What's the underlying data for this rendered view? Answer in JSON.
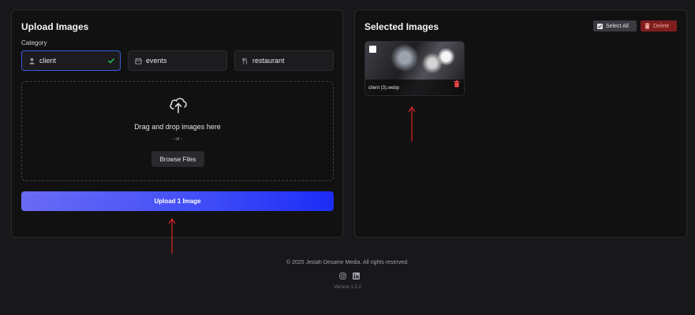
{
  "upload": {
    "title": "Upload Images",
    "category_label": "Category",
    "categories": [
      {
        "label": "client",
        "icon": "user-icon",
        "active": true
      },
      {
        "label": "events",
        "icon": "calendar-icon",
        "active": false
      },
      {
        "label": "restaurant",
        "icon": "utensils-icon",
        "active": false
      }
    ],
    "dropzone": {
      "text": "Drag and drop images here",
      "or": "- or -",
      "browse_label": "Browse Files"
    },
    "upload_button": "Upload 1 Image"
  },
  "selected": {
    "title": "Selected Images",
    "select_all_label": "Select All",
    "delete_label": "Delete",
    "images": [
      {
        "filename": "client (3).webp"
      }
    ]
  },
  "footer": {
    "copyright": "© 2025 Jesiah Desaine Media. All rights reserved.",
    "version": "Version 1.0.2"
  },
  "colors": {
    "background": "#18181b",
    "panel": "#111112",
    "accent": "#3b5bdb",
    "upload_gradient_start": "#6a6bf5",
    "upload_gradient_end": "#1d2cf7",
    "delete": "#7f1d1d",
    "annotation_arrow": "#dc2626"
  }
}
